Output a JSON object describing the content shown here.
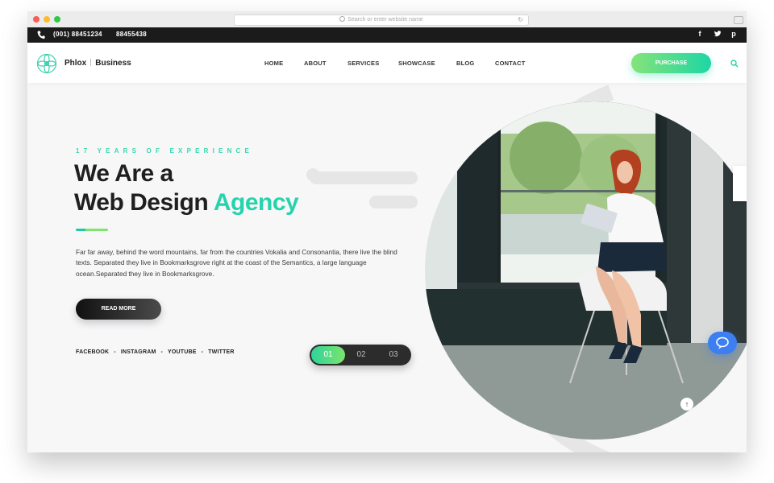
{
  "browser": {
    "address_placeholder": "Search or enter website name"
  },
  "topbar": {
    "phone_1": "(001) 88451234",
    "phone_2": "88455438",
    "social_icons": [
      "facebook-icon",
      "twitter-icon",
      "pinterest-icon"
    ],
    "social_glyphs": {
      "facebook": "f",
      "twitter": "t",
      "pinterest": "p"
    }
  },
  "header": {
    "logo_name": "Phlox",
    "logo_suffix": "Business",
    "nav": [
      "HOME",
      "ABOUT",
      "SERVICES",
      "SHOWCASE",
      "BLOG",
      "CONTACT"
    ],
    "purchase_label": "PURCHASE"
  },
  "hero": {
    "eyebrow": "17 YEARS OF EXPERIENCE",
    "title_line1": "We Are a",
    "title_line2_plain": "Web Design",
    "title_line2_accent": "Agency",
    "body": "Far far away, behind the word mountains, far from the countries Vokalia and Consonantia, there live the blind texts. Separated they live in Bookmarksgrove right at the coast of the Semantics, a large language ocean.Separated they live in Bookmarksgrove.",
    "read_more_label": "READ MORE",
    "social_links": [
      "FACEBOOK",
      "INSTAGRAM",
      "YOUTUBE",
      "TWITTER"
    ],
    "slides": [
      "01",
      "02",
      "03"
    ],
    "active_slide": "01"
  },
  "colors": {
    "accent": "#26d3ad",
    "accent_green": "#7ee46c",
    "dark": "#1b1b1b",
    "chat_blue": "#3d7ff0"
  }
}
